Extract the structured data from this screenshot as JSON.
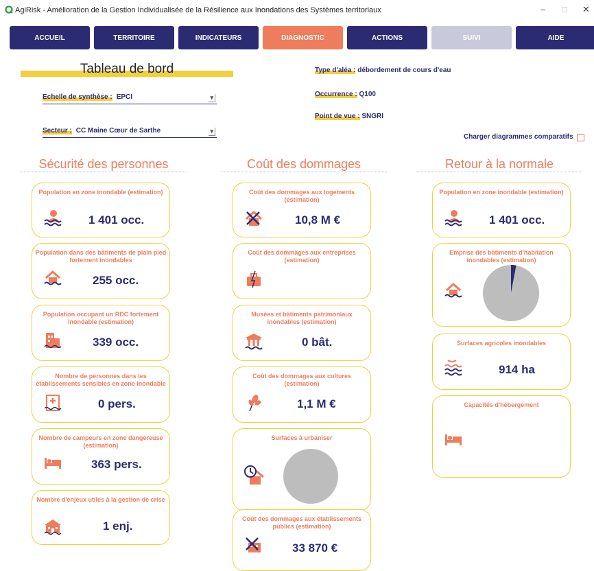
{
  "window": {
    "title": "AgiRisk - Amélioration de la Gestion Individualisée de la Résilience aux Inondations des Systèmes territoriaux",
    "minimize": "–",
    "maximize": "□",
    "close": "✕"
  },
  "nav": {
    "tabs": [
      {
        "label": "ACCUEIL",
        "state": "normal"
      },
      {
        "label": "TERRITOIRE",
        "state": "normal"
      },
      {
        "label": "INDICATEURS",
        "state": "normal"
      },
      {
        "label": "DIAGNOSTIC",
        "state": "active"
      },
      {
        "label": "ACTIONS",
        "state": "normal"
      },
      {
        "label": "SUIVI",
        "state": "disabled"
      },
      {
        "label": "AIDE",
        "state": "normal"
      }
    ]
  },
  "header": {
    "title": "Tableau de bord",
    "echelle_label": "Echelle de synthèse :",
    "echelle_value": "EPCI",
    "secteur_label": "Secteur :",
    "secteur_value": "CC Maine Cœur de Sarthe",
    "alea_label": "Type d'aléa :",
    "alea_value": "débordement de cours d'eau",
    "occurrence_label": "Occurrence :",
    "occurrence_value": "Q100",
    "pdv_label": "Point de vue :",
    "pdv_value": "SNGRI",
    "compare_label": "Charger diagrammes comparatifs"
  },
  "sections": {
    "securite": "Sécurité des personnes",
    "cout": "Coût des dommages",
    "retour": "Retour à la normale"
  },
  "cards": {
    "s1": {
      "title": "Population en zone inondable (estimation)",
      "value": "1 401 occ.",
      "icon": "person-flood-icon"
    },
    "s2": {
      "title": "Population dans des bâtiments de plain pied fortement inondables",
      "value": "255 occ.",
      "icon": "house-flood-icon"
    },
    "s3": {
      "title": "Population occupant un RDC fortement inondable (estimation)",
      "value": "339 occ.",
      "icon": "building-icon"
    },
    "s4": {
      "title": "Nombre de personnes dans les établissements sensibles en zone inondable",
      "value": "0 pers.",
      "icon": "hospital-icon"
    },
    "s5": {
      "title": "Nombre de campeurs en zone dangereuse (estimation)",
      "value": "363 pers.",
      "icon": "bed-icon"
    },
    "s6": {
      "title": "Nombre d'enjeux utiles à la gestion de crise",
      "value": "1 enj.",
      "icon": "school-icon"
    },
    "c1": {
      "title": "Coût des dommages aux logements (estimation)",
      "value": "10,8 M €",
      "icon": "house-tools-icon"
    },
    "c2": {
      "title": "Coût des dommages aux entreprises (estimation)",
      "value": "",
      "icon": "briefcase-icon"
    },
    "c3": {
      "title": "Musées et bâtiments patrimoniaux inondables (estimation)",
      "value": "0 bât.",
      "icon": "museum-icon"
    },
    "c4": {
      "title": "Coût des dommages aux cultures (estimation)",
      "value": "1,1 M €",
      "icon": "crop-icon"
    },
    "c5": {
      "title": "Surfaces à urbaniser",
      "value": "",
      "icon": "house-clock-icon"
    },
    "c6": {
      "title": "Coût des dommages aux établissements publics (estimation)",
      "value": "33 870  €",
      "icon": "public-building-tools-icon"
    },
    "r1": {
      "title": "Population en zone inondable (estimation)",
      "value": "1 401 occ.",
      "icon": "person-flood-icon"
    },
    "r2": {
      "title": "Emprise des bâtiments d'habitation inondables (estimation)",
      "value": "",
      "icon": "house-flood-icon"
    },
    "r3": {
      "title": "Surfaces agricoles inondables",
      "value": "914 ha",
      "icon": "field-flood-icon"
    },
    "r4": {
      "title": "Capacités d'hébergement",
      "value": "",
      "icon": "bed-icon"
    }
  },
  "colors": {
    "navy": "#2b2b73",
    "orange": "#ef7c5c",
    "yellow": "#f5ce3c",
    "disabled": "#c9c9dc",
    "pie_grey": "#bdbdbd"
  },
  "chart_data": [
    {
      "type": "pie",
      "slices": [
        {
          "value": 0.03,
          "color": "#2b2b73"
        },
        {
          "value": 0.97,
          "color": "#bdbdbd"
        }
      ]
    },
    {
      "type": "pie",
      "slices": [
        {
          "value": 1.0,
          "color": "#bdbdbd"
        }
      ]
    }
  ]
}
